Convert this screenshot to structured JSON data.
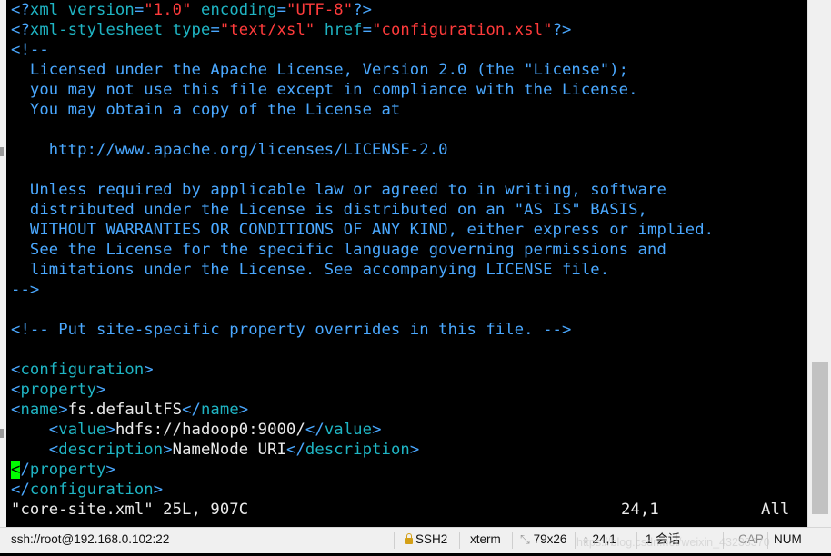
{
  "editor": {
    "lines": [
      [
        {
          "t": "<?",
          "c": "tag"
        },
        {
          "t": "xml",
          "c": "name"
        },
        {
          "t": " version",
          "c": "name"
        },
        {
          "t": "=",
          "c": "tag"
        },
        {
          "t": "\"1.0\"",
          "c": "str"
        },
        {
          "t": " encoding",
          "c": "name"
        },
        {
          "t": "=",
          "c": "tag"
        },
        {
          "t": "\"UTF-8\"",
          "c": "str"
        },
        {
          "t": "?>",
          "c": "tag"
        }
      ],
      [
        {
          "t": "<?",
          "c": "tag"
        },
        {
          "t": "xml-stylesheet",
          "c": "name"
        },
        {
          "t": " type",
          "c": "name"
        },
        {
          "t": "=",
          "c": "tag"
        },
        {
          "t": "\"text/xsl\"",
          "c": "str"
        },
        {
          "t": " href",
          "c": "name"
        },
        {
          "t": "=",
          "c": "tag"
        },
        {
          "t": "\"configuration.xsl\"",
          "c": "str"
        },
        {
          "t": "?>",
          "c": "tag"
        }
      ],
      [
        {
          "t": "<!--",
          "c": "cmt"
        }
      ],
      [
        {
          "t": "  Licensed under the Apache License, Version 2.0 (the \"License\");",
          "c": "cmt"
        }
      ],
      [
        {
          "t": "  you may not use this file except in compliance with the License.",
          "c": "cmt"
        }
      ],
      [
        {
          "t": "  You may obtain a copy of the License at",
          "c": "cmt"
        }
      ],
      [],
      [
        {
          "t": "    http://www.apache.org/licenses/LICENSE-2.0",
          "c": "cmt"
        }
      ],
      [],
      [
        {
          "t": "  Unless required by applicable law or agreed to in writing, software",
          "c": "cmt"
        }
      ],
      [
        {
          "t": "  distributed under the License is distributed on an \"AS IS\" BASIS,",
          "c": "cmt"
        }
      ],
      [
        {
          "t": "  WITHOUT WARRANTIES OR CONDITIONS OF ANY KIND, either express or implied.",
          "c": "cmt"
        }
      ],
      [
        {
          "t": "  See the License for the specific language governing permissions and",
          "c": "cmt"
        }
      ],
      [
        {
          "t": "  limitations under the License. See accompanying LICENSE file.",
          "c": "cmt"
        }
      ],
      [
        {
          "t": "-->",
          "c": "cmt"
        }
      ],
      [],
      [
        {
          "t": "<!-- Put site-specific property overrides in this file. -->",
          "c": "cmt"
        }
      ],
      [],
      [
        {
          "t": "<",
          "c": "tag"
        },
        {
          "t": "configuration",
          "c": "name"
        },
        {
          "t": ">",
          "c": "tag"
        }
      ],
      [
        {
          "t": "<",
          "c": "tag"
        },
        {
          "t": "property",
          "c": "name"
        },
        {
          "t": ">",
          "c": "tag"
        }
      ],
      [
        {
          "t": "<",
          "c": "tag"
        },
        {
          "t": "name",
          "c": "name"
        },
        {
          "t": ">",
          "c": "tag"
        },
        {
          "t": "fs.defaultFS",
          "c": "txt"
        },
        {
          "t": "</",
          "c": "tag"
        },
        {
          "t": "name",
          "c": "name"
        },
        {
          "t": ">",
          "c": "tag"
        }
      ],
      [
        {
          "t": "    <",
          "c": "tag"
        },
        {
          "t": "value",
          "c": "name"
        },
        {
          "t": ">",
          "c": "tag"
        },
        {
          "t": "hdfs://hadoop0:9000/",
          "c": "txt"
        },
        {
          "t": "</",
          "c": "tag"
        },
        {
          "t": "value",
          "c": "name"
        },
        {
          "t": ">",
          "c": "tag"
        }
      ],
      [
        {
          "t": "    <",
          "c": "tag"
        },
        {
          "t": "description",
          "c": "name"
        },
        {
          "t": ">",
          "c": "tag"
        },
        {
          "t": "NameNode URI",
          "c": "txt"
        },
        {
          "t": "</",
          "c": "tag"
        },
        {
          "t": "description",
          "c": "name"
        },
        {
          "t": ">",
          "c": "tag"
        }
      ],
      [
        {
          "t": "<",
          "c": "cursor"
        },
        {
          "t": "/",
          "c": "tag"
        },
        {
          "t": "property",
          "c": "name"
        },
        {
          "t": ">",
          "c": "tag"
        }
      ],
      [
        {
          "t": "</",
          "c": "tag"
        },
        {
          "t": "configuration",
          "c": "name"
        },
        {
          "t": ">",
          "c": "tag"
        }
      ]
    ],
    "vim_status": {
      "file_info": "\"core-site.xml\" 25L, 907C",
      "position": "24,1",
      "scroll": "All"
    }
  },
  "statusbar": {
    "connection": "ssh://root@192.168.0.102:22",
    "protocol": "SSH2",
    "terminal_type": "xterm",
    "size": "79x26",
    "cursor_pos": "24,1",
    "sessions": "1 会话",
    "caps": "CAP",
    "num": "NUM",
    "watermark": "https://blog.csdn.net/weixin_43238370"
  },
  "colors": {
    "tag": "#4aa8ff",
    "name": "#1fb5c4",
    "string": "#ff3b3b",
    "comment": "#4aa8ff",
    "text": "#eaeaea",
    "cursor": "#00ff00"
  }
}
